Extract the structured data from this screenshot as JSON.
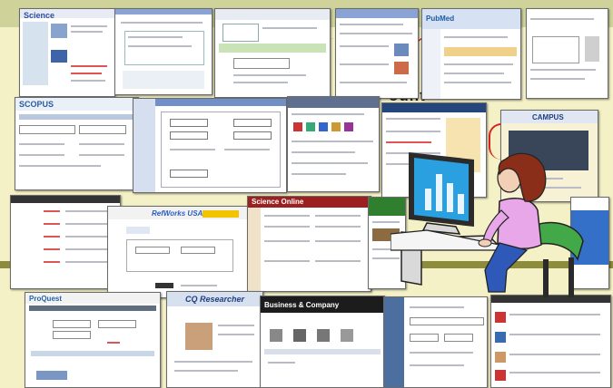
{
  "collage": {
    "background": "#f4f1c6",
    "heading_fragment": "ount",
    "thumbs": [
      {
        "id": "science",
        "title": "Science",
        "accent": "#2b4ea3"
      },
      {
        "id": "refworks",
        "title": "",
        "accent": "#3b6fb7"
      },
      {
        "id": "library",
        "title": "",
        "accent": "#5c7fa8"
      },
      {
        "id": "search-results",
        "title": "",
        "accent": "#8aa3d4"
      },
      {
        "id": "pubmed",
        "title": "PubMed",
        "accent": "#1d5aa6"
      },
      {
        "id": "stats",
        "title": "",
        "accent": "#888888"
      },
      {
        "id": "scopus",
        "title": "SCOPUS",
        "accent": "#2a5c9c"
      },
      {
        "id": "advanced-search",
        "title": "",
        "accent": "#6f8fc6"
      },
      {
        "id": "icons",
        "title": "",
        "accent": "#5f6f8f"
      },
      {
        "id": "catalog",
        "title": "",
        "accent": "#25467a"
      },
      {
        "id": "campus",
        "title": "CAMPUS",
        "accent": "#c4a000"
      },
      {
        "id": "links",
        "title": "",
        "accent": "#cc3333"
      },
      {
        "id": "refworks-usa",
        "title": "RefWorks USA",
        "accent": "#2b5fbf"
      },
      {
        "id": "science-online",
        "title": "Science Online",
        "accent": "#9c2020"
      },
      {
        "id": "green-panel",
        "title": "",
        "accent": "#2f7f2f"
      },
      {
        "id": "proquest",
        "title": "ProQuest",
        "accent": "#2563a8"
      },
      {
        "id": "cq-researcher",
        "title": "CQ Researcher",
        "accent": "#1f3f80"
      },
      {
        "id": "business",
        "title": "Business & Company",
        "accent": "#1c1c1c"
      },
      {
        "id": "form",
        "title": "",
        "accent": "#6b8bbd"
      },
      {
        "id": "books",
        "title": "",
        "accent": "#333333"
      }
    ],
    "clipart": {
      "name": "woman-at-computer",
      "monitor": "#2aa0e0",
      "chair": "#43a847",
      "shirt": "#e7a7e8",
      "hair": "#8a2e1a"
    }
  }
}
